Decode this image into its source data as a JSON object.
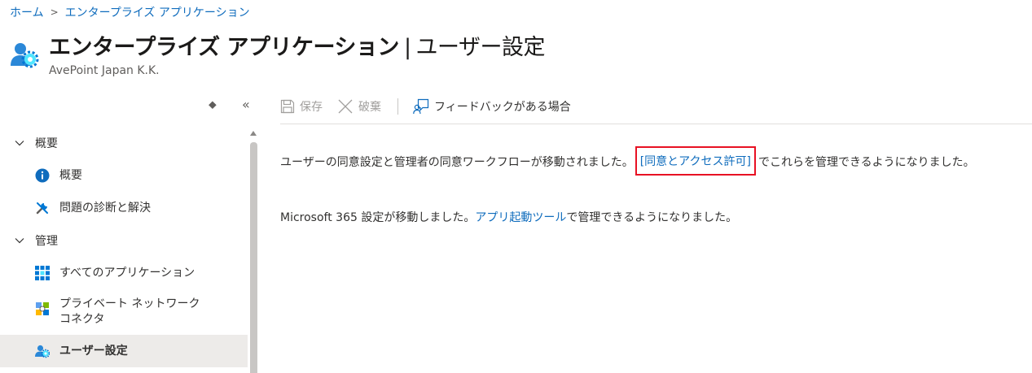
{
  "breadcrumb": {
    "home": "ホーム",
    "current": "エンタープライズ アプリケーション"
  },
  "header": {
    "title_main": "エンタープライズ アプリケーション",
    "title_sep": "|",
    "title_sub": "ユーザー設定",
    "more": "···",
    "org": "AvePoint Japan K.K."
  },
  "sidebar": {
    "groups": [
      {
        "label": "概要",
        "items": [
          {
            "label": "概要",
            "icon": "info-icon"
          },
          {
            "label": "問題の診断と解決",
            "icon": "wrench-icon"
          }
        ]
      },
      {
        "label": "管理",
        "items": [
          {
            "label": "すべてのアプリケーション",
            "icon": "grid-apps-icon"
          },
          {
            "label": "プライベート ネットワーク コネクタ",
            "icon": "connector-icon"
          },
          {
            "label": "ユーザー設定",
            "icon": "user-settings-icon",
            "selected": true
          }
        ]
      }
    ]
  },
  "toolbar": {
    "save": "保存",
    "discard": "破棄",
    "feedback": "フィードバックがある場合"
  },
  "content": {
    "line1_before": "ユーザーの同意設定と管理者の同意ワークフローが移動されました。",
    "line1_link": "[同意とアクセス許可]",
    "line1_after": "でこれらを管理できるようになりました。",
    "line2_before": "Microsoft 365 設定が移動しました。",
    "line2_link": "アプリ起動ツール",
    "line2_after": "で管理できるようになりました。"
  },
  "colors": {
    "link": "#0f6cbd",
    "highlight_box": "#e81123",
    "selected_bg": "#edebe9"
  }
}
